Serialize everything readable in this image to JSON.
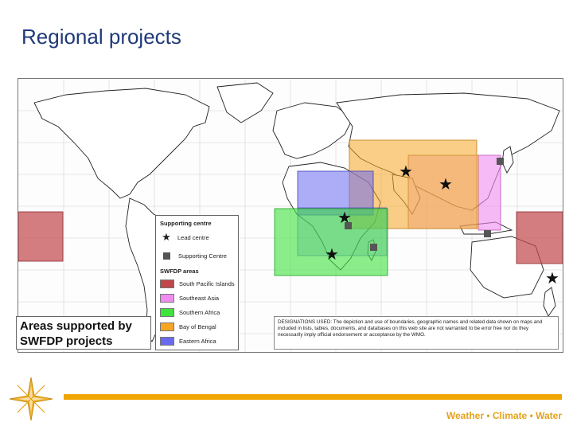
{
  "page": {
    "title": "Regional projects"
  },
  "map": {
    "regions": [
      {
        "name": "South Pacific Islands",
        "color": "#c0464a"
      },
      {
        "name": "Southeast Asia",
        "color": "#f08cf0"
      },
      {
        "name": "Southern Africa",
        "color": "#3ee33e"
      },
      {
        "name": "Bay of Bengal",
        "color": "#f6a623"
      },
      {
        "name": "Eastern Africa",
        "color": "#6a6af0"
      }
    ]
  },
  "legend": {
    "supporting_header": "Supporting centre",
    "lead_label": "Lead centre",
    "support_label": "Supporting Centre",
    "areas_header": "SWFDP areas",
    "areas": [
      {
        "label": "South Pacific Islands",
        "color": "#c0464a"
      },
      {
        "label": "Southeast Asia",
        "color": "#f08cf0"
      },
      {
        "label": "Southern Africa",
        "color": "#3ee33e"
      },
      {
        "label": "Bay of Bengal",
        "color": "#f6a623"
      },
      {
        "label": "Eastern Africa",
        "color": "#6a6af0"
      }
    ]
  },
  "caption": {
    "line1": "Areas supported by",
    "line2": "SWFDP projects"
  },
  "disclaimer": {
    "text": "DESIGNATIONS USED: The depiction and use of boundaries, geographic names and related data shown on maps and included in lists, tables, documents, and databases on this web site are not warranted to be error free nor do they necessarily imply official endorsement or acceptance by the WMO."
  },
  "footer": {
    "tagline": "Weather • Climate • Water"
  },
  "colors": {
    "accent": "#f0a500",
    "title": "#1f3a7a"
  }
}
